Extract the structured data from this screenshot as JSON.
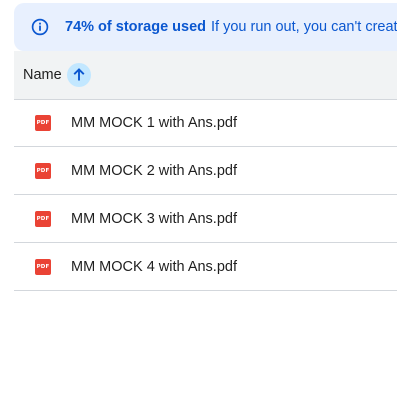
{
  "storage_banner": {
    "icon": "info-icon",
    "headline": "74% of storage used",
    "message": "If you run out, you can't create",
    "accent_color": "#0b57d0",
    "background_color": "#e8f0fe"
  },
  "file_list": {
    "columns": [
      {
        "label": "Name",
        "sort": "ascending",
        "sort_icon": "arrow-up-icon"
      }
    ],
    "files": [
      {
        "name": "MM MOCK 1 with Ans.pdf",
        "icon_text": "PDF"
      },
      {
        "name": "MM MOCK 2 with Ans.pdf",
        "icon_text": "PDF"
      },
      {
        "name": "MM MOCK 3 with Ans.pdf",
        "icon_text": "PDF"
      },
      {
        "name": "MM MOCK 4 with Ans.pdf",
        "icon_text": "PDF"
      }
    ]
  }
}
